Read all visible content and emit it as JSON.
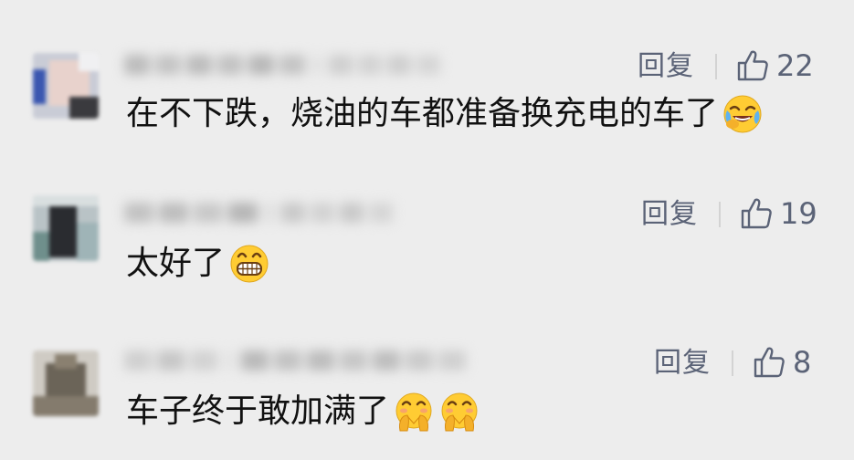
{
  "comments": [
    {
      "reply_label": "回复",
      "likes": "22",
      "text": "在不下跌，烧油的车都准备换充电的车了",
      "emoji": [
        "laughing-tears-emoji"
      ]
    },
    {
      "reply_label": "回复",
      "likes": "19",
      "text": "太好了",
      "emoji": [
        "grinning-teeth-emoji"
      ]
    },
    {
      "reply_label": "回复",
      "likes": "8",
      "text": "车子终于敢加满了",
      "emoji": [
        "face-with-hand-over-mouth-emoji",
        "face-with-hand-over-mouth-emoji"
      ]
    }
  ],
  "icons": {
    "like": "thumbs-up-outline-icon"
  },
  "colors": {
    "background": "#ededed",
    "action_text": "#5b6377",
    "emoji_yellow": "#ffcc33"
  }
}
